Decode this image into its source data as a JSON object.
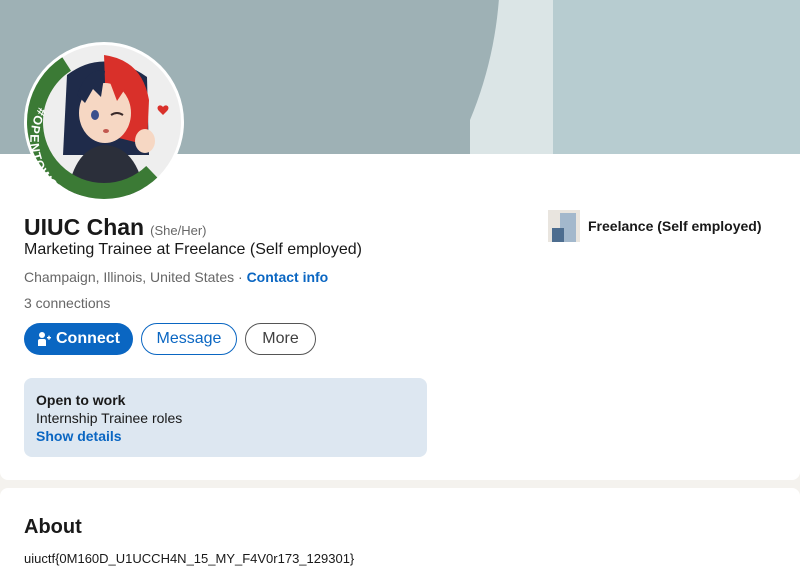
{
  "profile": {
    "name": "UIUC Chan",
    "pronouns": "(She/Her)",
    "headline": "Marketing Trainee at Freelance (Self employed)",
    "location": "Champaign, Illinois, United States",
    "separator": " · ",
    "contact_label": "Contact info",
    "connections": "3 connections",
    "avatar_badge": "#OPENTOWORK"
  },
  "actions": {
    "connect_label": "Connect",
    "message_label": "Message",
    "more_label": "More"
  },
  "open_to_work": {
    "title": "Open to work",
    "roles": "Internship Trainee roles",
    "link": "Show details"
  },
  "company": {
    "name": "Freelance (Self employed)"
  },
  "about": {
    "title": "About",
    "text": "uiuctf{0M160D_U1UCCH4N_15_MY_F4V0r173_129301}"
  },
  "colors": {
    "accent": "#0a66c2",
    "opentowork_ring": "#3b7a35",
    "banner": "#9eb1b5"
  },
  "icons": [
    "person-add-icon",
    "company-logo-icon"
  ]
}
